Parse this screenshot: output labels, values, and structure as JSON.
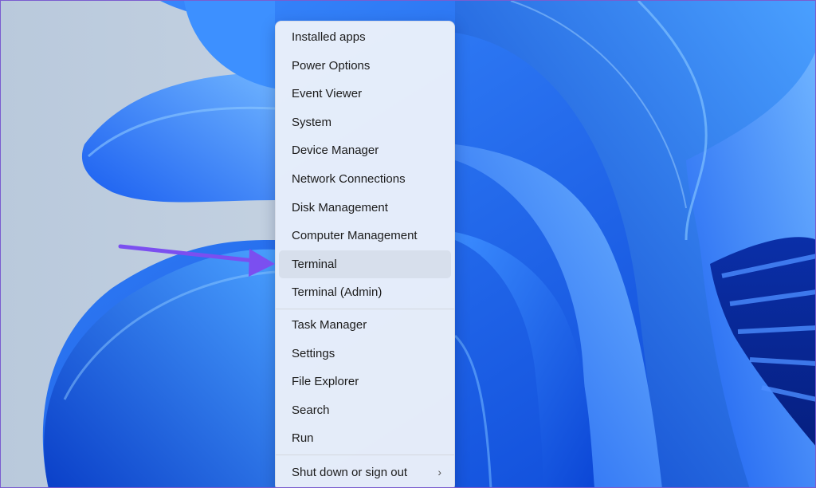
{
  "menu": {
    "group1": [
      "Installed apps",
      "Power Options",
      "Event Viewer",
      "System",
      "Device Manager",
      "Network Connections",
      "Disk Management",
      "Computer Management",
      "Terminal",
      "Terminal (Admin)"
    ],
    "group2": [
      "Task Manager",
      "Settings",
      "File Explorer",
      "Search",
      "Run"
    ],
    "shutdown_label": "Shut down or sign out",
    "submenu_chevron": "›",
    "highlighted_item": "Terminal"
  },
  "colors": {
    "wallpaper_blue": "#1f6cf0",
    "wallpaper_light": "#c9d6e4",
    "arrow": "#7b4ff0",
    "menu_bg": "#ecf1fa"
  },
  "icons": {
    "annotation": "arrow-annotation-icon",
    "submenu": "chevron-right-icon"
  }
}
